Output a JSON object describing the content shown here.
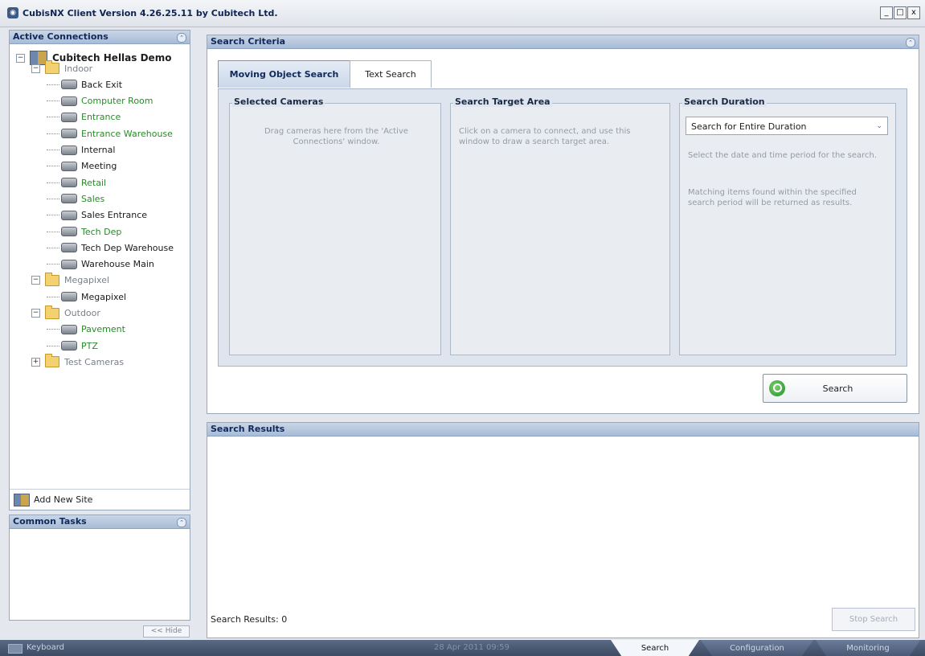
{
  "window": {
    "title": "CubisNX Client Version 4.26.25.11 by Cubitech Ltd.",
    "minimize": "_",
    "maximize": "□",
    "close": "x"
  },
  "active_connections": {
    "title": "Active Connections",
    "site": "Cubitech Hellas Demo",
    "groups": [
      {
        "name": "Indoor",
        "cameras": [
          {
            "name": "Back Exit",
            "status": "black"
          },
          {
            "name": "Computer Room",
            "status": "green"
          },
          {
            "name": "Entrance",
            "status": "green"
          },
          {
            "name": "Entrance Warehouse",
            "status": "green"
          },
          {
            "name": "Internal",
            "status": "black"
          },
          {
            "name": "Meeting",
            "status": "black"
          },
          {
            "name": "Retail",
            "status": "green"
          },
          {
            "name": "Sales",
            "status": "green"
          },
          {
            "name": "Sales Entrance",
            "status": "black"
          },
          {
            "name": "Tech Dep",
            "status": "green"
          },
          {
            "name": "Tech Dep Warehouse",
            "status": "black"
          },
          {
            "name": "Warehouse Main",
            "status": "black"
          }
        ]
      },
      {
        "name": "Megapixel",
        "cameras": [
          {
            "name": "Megapixel",
            "status": "black"
          }
        ]
      },
      {
        "name": "Outdoor",
        "cameras": [
          {
            "name": "Pavement",
            "status": "green"
          },
          {
            "name": "PTZ",
            "status": "green"
          }
        ]
      },
      {
        "name": "Test Cameras",
        "cameras": []
      }
    ],
    "add_new_site": "Add New Site"
  },
  "common_tasks": {
    "title": "Common Tasks",
    "hide": "<< Hide"
  },
  "search_criteria": {
    "title": "Search Criteria",
    "tabs": [
      "Moving Object Search",
      "Text Search"
    ],
    "selected_cameras": {
      "title": "Selected Cameras",
      "hint": "Drag cameras here from the 'Active Connections' window."
    },
    "search_target_area": {
      "title": "Search Target Area",
      "hint": "Click on a camera to connect, and use this window to draw a search target area."
    },
    "search_duration": {
      "title": "Search Duration",
      "selected": "Search for Entire Duration",
      "hint1": "Select the date and time period for the search.",
      "hint2": "Matching items found within the specified search period will be returned as results."
    },
    "search_button": "Search"
  },
  "search_results": {
    "title": "Search Results",
    "count_label": "Search Results: 0",
    "stop_button": "Stop Search"
  },
  "bottom_bar": {
    "keyboard": "Keyboard",
    "datetime": "28 Apr 2011 09:59",
    "tabs": [
      "Search",
      "Configuration",
      "Monitoring"
    ]
  }
}
